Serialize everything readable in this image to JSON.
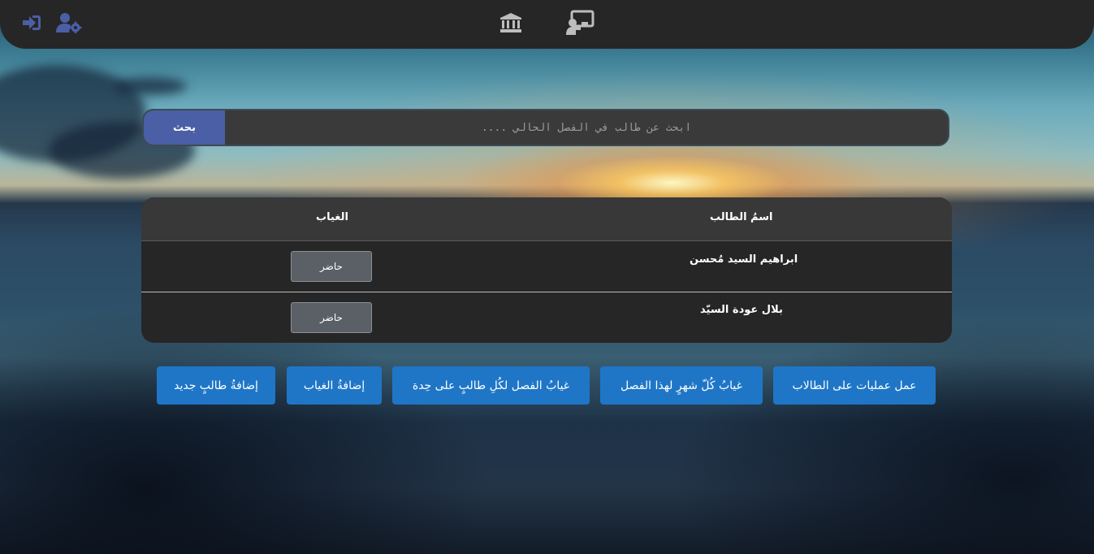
{
  "header": {
    "icons": [
      "logout-icon",
      "user-settings-icon",
      "institution-icon",
      "teacher-board-icon"
    ],
    "icon_color": "#4a5fa6"
  },
  "search": {
    "button_label": "بحث",
    "placeholder": "ابحث عن طالب في الفصل الحالي ....",
    "value": ""
  },
  "table": {
    "headers": {
      "name": "اسمُ الطالب",
      "absence": "الغياب"
    },
    "rows": [
      {
        "name": "ابراهيم السيد مُحسن",
        "status": "حاضر"
      },
      {
        "name": "بلال عودة السيّد",
        "status": "حاضر"
      }
    ]
  },
  "actions": {
    "student_ops": "عمل عمليات على الطالاب",
    "monthly_absence": "غيابُ كُلّ شهرٍ لهذا الفصل",
    "class_absence_each": "غيابُ الفصل لكُلِ طالبٍ على حِدة",
    "add_absence": "إضافةُ الغياب",
    "add_student": "إضافةُ طالبٍ جديد"
  },
  "colors": {
    "accent": "#4a5fa6",
    "action_blue": "#1f76c7",
    "panel": "#262626"
  }
}
